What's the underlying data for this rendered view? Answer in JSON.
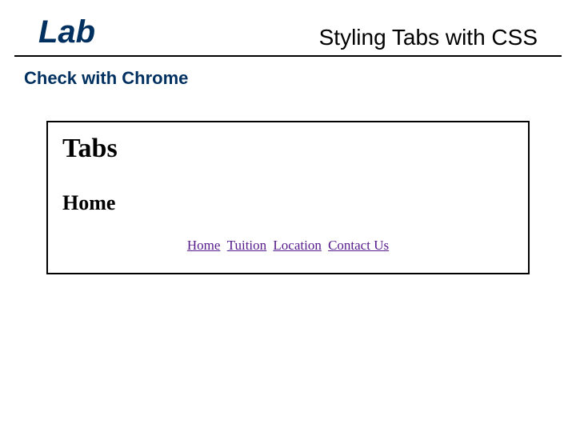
{
  "header": {
    "lab": "Lab",
    "title": "Styling Tabs with CSS"
  },
  "subtitle": "Check with Chrome",
  "screenshot": {
    "h1": "Tabs",
    "h2": "Home",
    "links": [
      "Home",
      "Tuition",
      "Location",
      "Contact Us"
    ]
  }
}
